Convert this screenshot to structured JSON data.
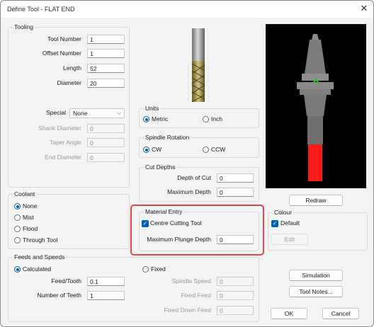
{
  "window": {
    "title": "Define Tool - FLAT END",
    "close_glyph": "✕"
  },
  "tooling": {
    "label": "Tooling",
    "tool_number": {
      "label": "Tool Number",
      "value": "1"
    },
    "offset_number": {
      "label": "Offset Number",
      "value": "1"
    },
    "length": {
      "label": "Length",
      "value": "52"
    },
    "diameter": {
      "label": "Diameter",
      "value": "20"
    },
    "special": {
      "label": "Special",
      "value": "None"
    },
    "shank_diameter": {
      "label": "Shank Diameter",
      "value": "0"
    },
    "taper_angle": {
      "label": "Taper Angle",
      "value": "0"
    },
    "end_diameter": {
      "label": "End Diameter",
      "value": "0"
    }
  },
  "units": {
    "label": "Units",
    "options": [
      "Metric",
      "Inch"
    ],
    "selected": "Metric"
  },
  "spindle_rotation": {
    "label": "Spindle Rotation",
    "options": [
      "CW",
      "CCW"
    ],
    "selected": "CW"
  },
  "cut_depths": {
    "label": "Cut Depths",
    "depth_of_cut": {
      "label": "Depth of Cut",
      "value": "0"
    },
    "maximum_depth": {
      "label": "Maximum Depth",
      "value": "0"
    }
  },
  "coolant": {
    "label": "Coolant",
    "options": [
      "None",
      "Mist",
      "Flood",
      "Through Tool"
    ],
    "selected": "None"
  },
  "material_entry": {
    "label": "Material Entry",
    "centre_cutting": {
      "label": "Centre Cutting Tool",
      "checked": true
    },
    "max_plunge_depth": {
      "label": "Maximum Plunge Depth",
      "value": "0"
    }
  },
  "colour": {
    "label": "Colour",
    "default": {
      "label": "Default",
      "checked": true
    },
    "edit_label": "Edit"
  },
  "feeds_speeds": {
    "label": "Feeds and Speeds",
    "calculated_label": "Calculated",
    "fixed_label": "Fixed",
    "selected": "Calculated",
    "feed_tooth": {
      "label": "Feed/Tooth",
      "value": "0.1"
    },
    "number_of_teeth": {
      "label": "Number of Teeth",
      "value": "1"
    },
    "spindle_speed": {
      "label": "Spindle Speed",
      "value": "0"
    },
    "fixed_feed": {
      "label": "Fixed Feed",
      "value": "0"
    },
    "fixed_down_feed": {
      "label": "Fixed Down Feed",
      "value": "0"
    }
  },
  "buttons": {
    "redraw": "Redraw",
    "simulation": "Simulation",
    "tool_notes": "Tool Notes...",
    "ok": "OK",
    "cancel": "Cancel"
  },
  "colors": {
    "accent": "#005fb8",
    "highlight": "#e14848",
    "tool_body": "#808080",
    "cutter": "#ff1a1a",
    "marker": "#22c52a",
    "preview_bg": "#000000"
  },
  "icons": {
    "check": "✓",
    "chevron": "⌵"
  }
}
